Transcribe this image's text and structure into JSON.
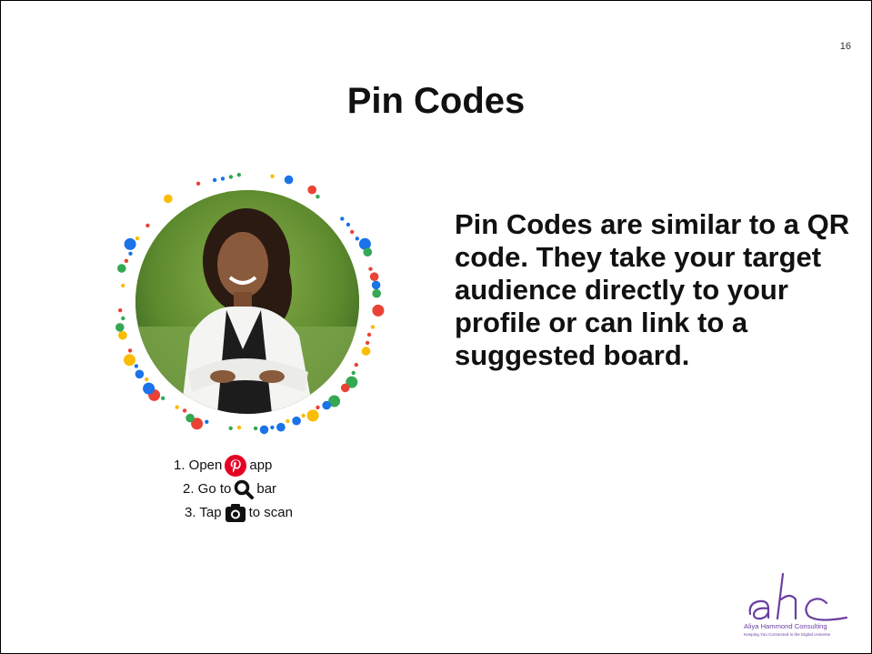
{
  "slide": {
    "page_number": "16",
    "title": "Pin Codes",
    "body_text": "Pin Codes are similar to a QR code. They take your target audience directly to your profile or can link to a suggested board."
  },
  "instructions": {
    "step1_before": "1. Open",
    "step1_after": "app",
    "step1_icon": "pinterest-icon",
    "step2_before": "2. Go to",
    "step2_after": "bar",
    "step2_icon": "search-icon",
    "step3_before": "3. Tap",
    "step3_after": "to scan",
    "step3_icon": "camera-icon"
  },
  "logo": {
    "mark": "ahc",
    "name": "Aliya Hammond Consulting",
    "tagline": "Keeping You Connected in the Digital Universe"
  },
  "colors": {
    "dot_blue": "#1a73e8",
    "dot_red": "#ea4335",
    "dot_yellow": "#fbbc04",
    "dot_green": "#34a853",
    "pinterest_red": "#e60023",
    "logo_purple": "#6b3fa0"
  }
}
